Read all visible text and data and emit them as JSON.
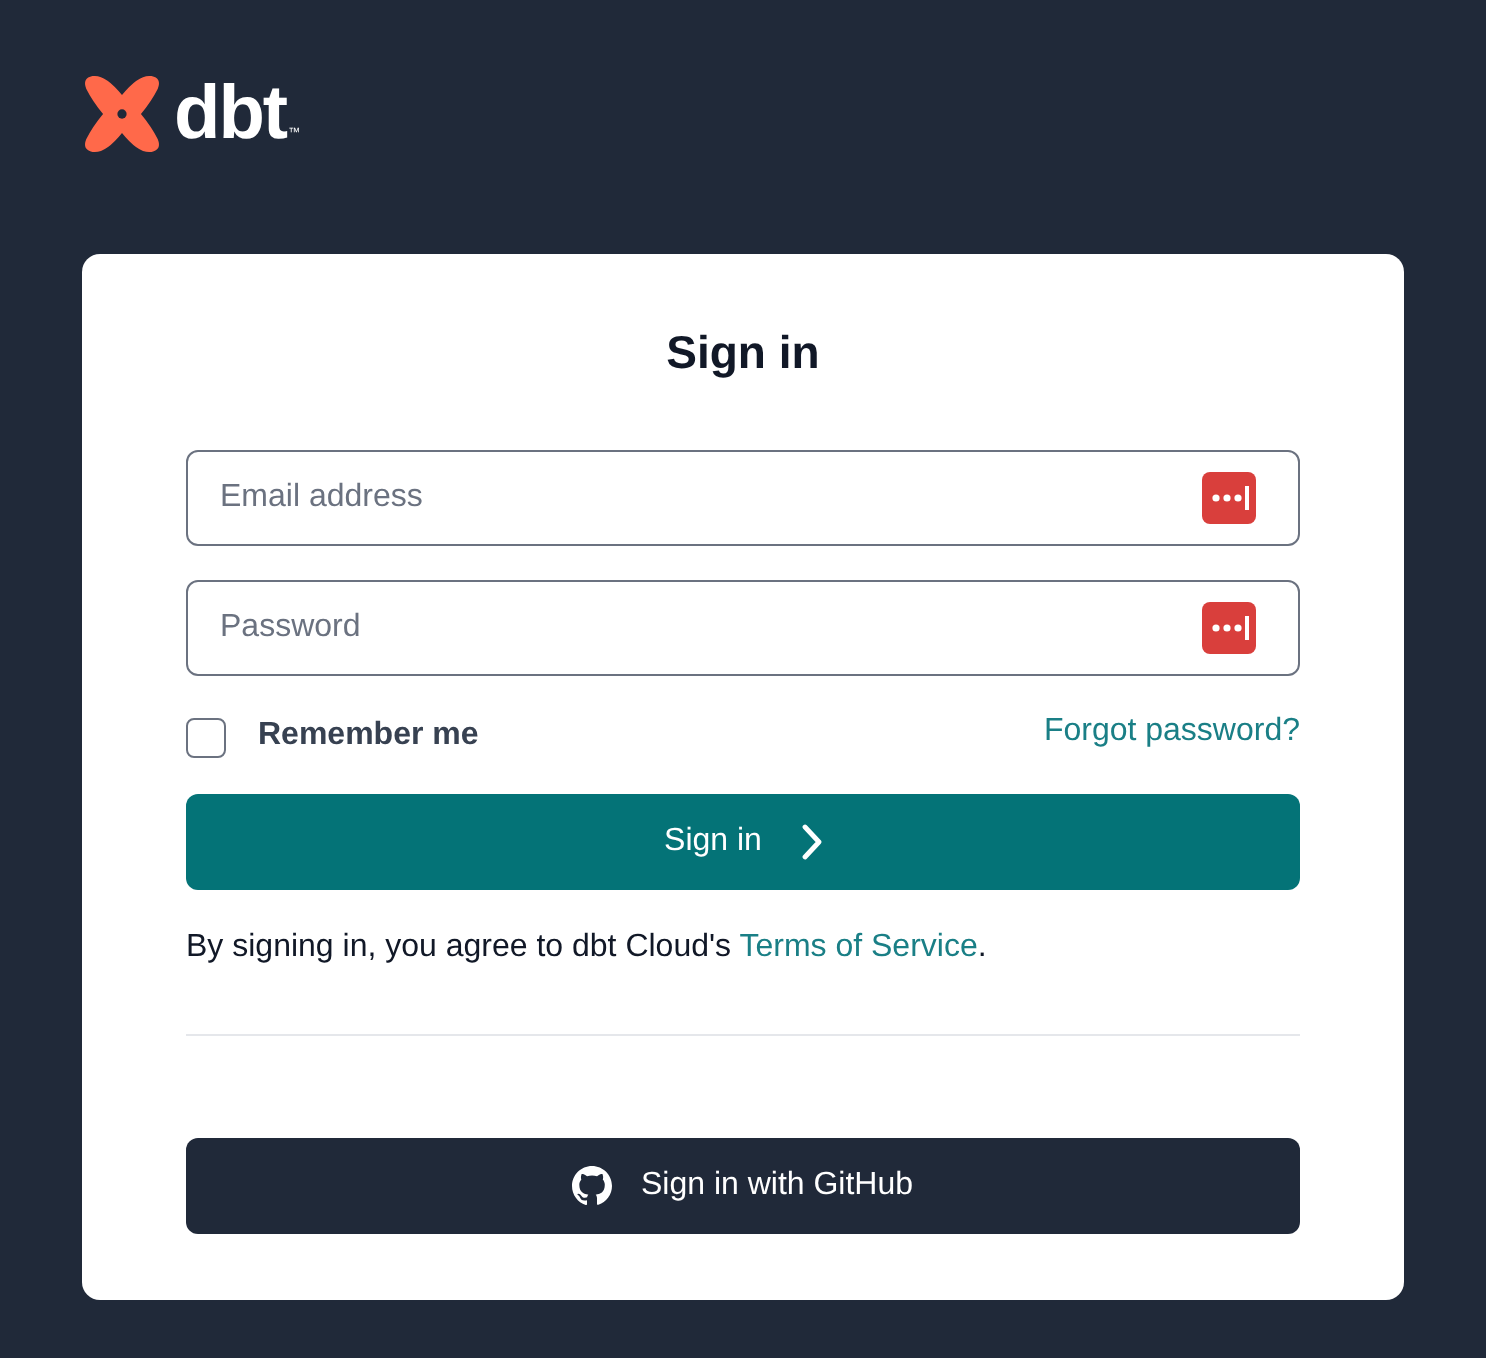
{
  "logo": {
    "wordmark": "dbt",
    "trademark": "™"
  },
  "card": {
    "title": "Sign in",
    "fields": [
      {
        "placeholder": "Email address"
      },
      {
        "placeholder": "Password"
      }
    ],
    "remember": {
      "label": "Remember me",
      "checked": false
    },
    "forgot_link": "Forgot password?",
    "submit": {
      "label": "Sign in"
    },
    "terms": {
      "text": "By signing in, you agree to dbt Cloud's ",
      "link": "Terms of Service",
      "after": "."
    },
    "sso_button": {
      "label": "Sign in with GitHub"
    }
  }
}
